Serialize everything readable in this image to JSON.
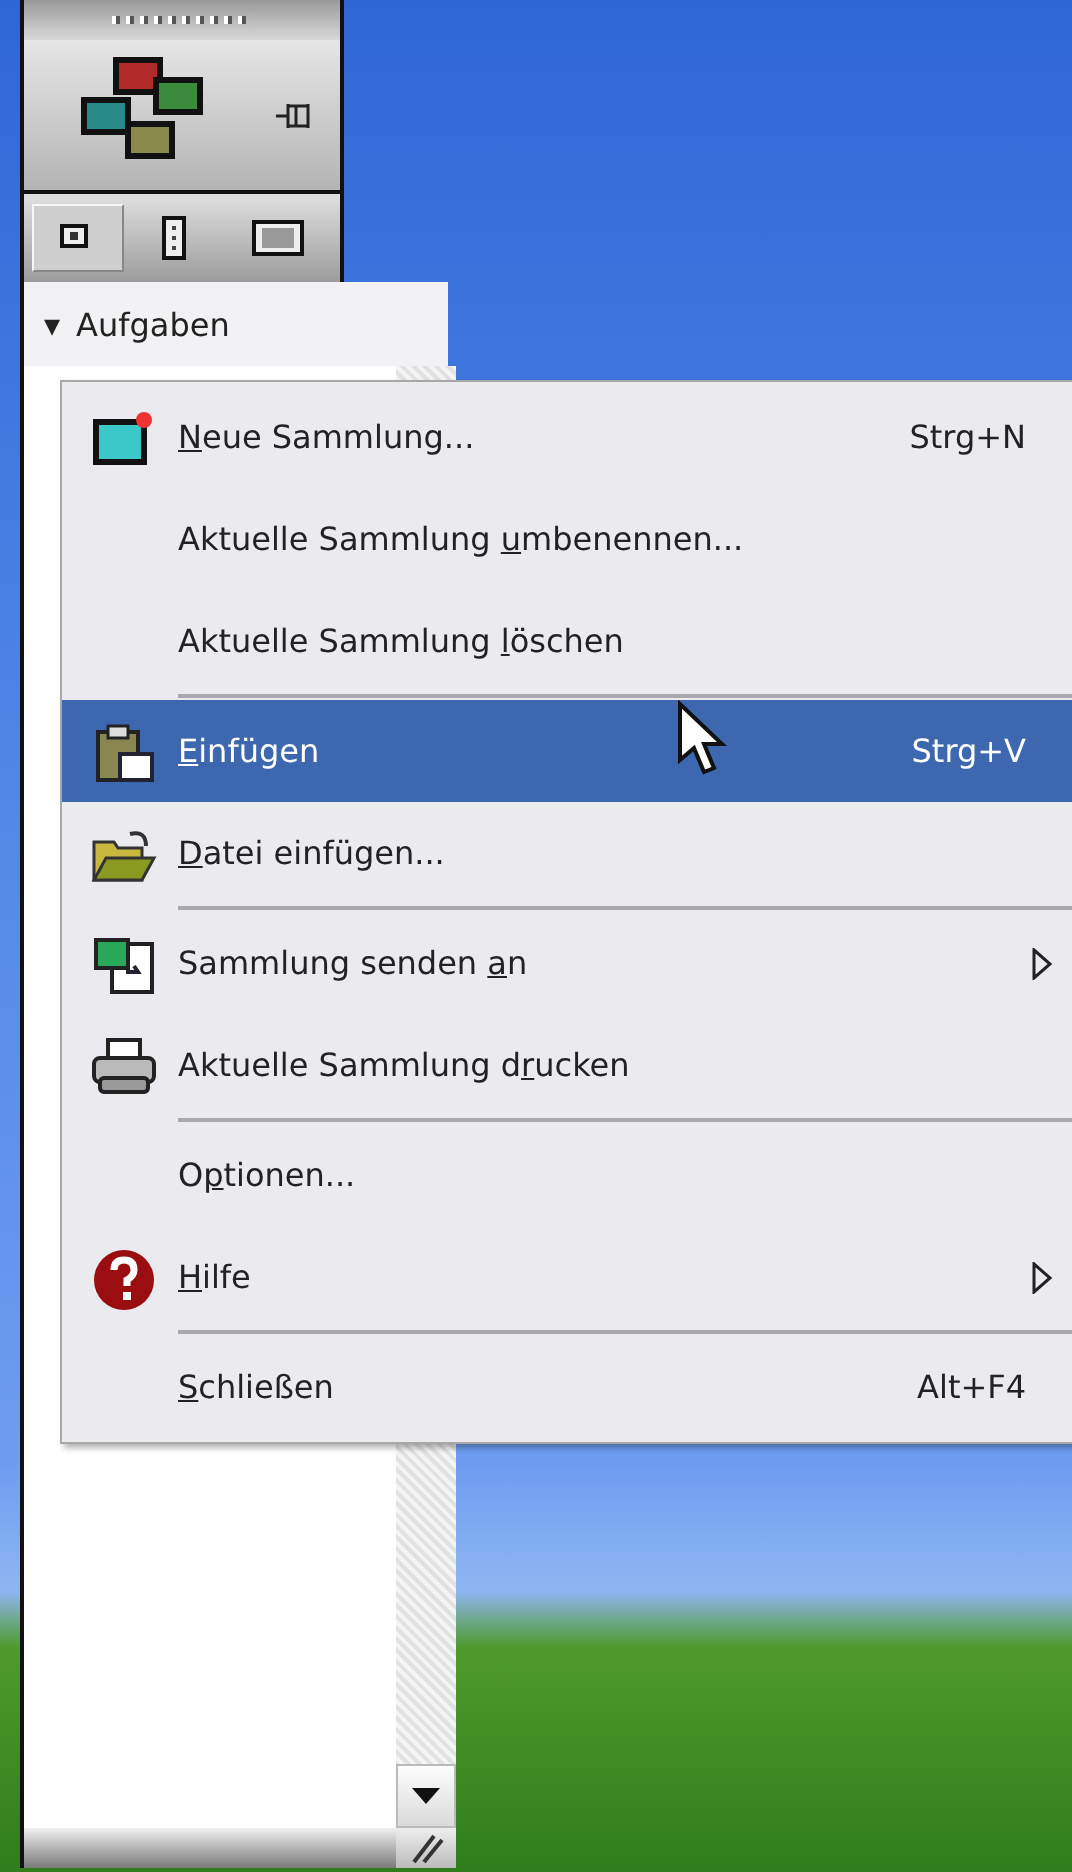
{
  "pane": {
    "view_buttons": [
      {
        "kind": "single",
        "selected": true
      },
      {
        "kind": "list",
        "selected": false
      },
      {
        "kind": "large",
        "selected": false
      }
    ],
    "tasks_header": {
      "arrow": "▾",
      "label": "Aufgaben"
    }
  },
  "menu": {
    "items": [
      {
        "kind": "item",
        "label": {
          "key": "N",
          "after": "eue Sammlung..."
        },
        "shortcut": "Strg+N",
        "submenu": false,
        "selected": false
      },
      {
        "kind": "item",
        "label": {
          "before": "Aktuelle Sammlung ",
          "key": "u",
          "after": "mbenennen..."
        },
        "submenu": false,
        "selected": false
      },
      {
        "kind": "item",
        "label": {
          "before": "Aktuelle Sammlung ",
          "key": "l",
          "after": "öschen"
        },
        "submenu": false,
        "selected": false
      },
      {
        "kind": "separator"
      },
      {
        "kind": "item",
        "label": {
          "key": "E",
          "after": "infügen"
        },
        "shortcut": "Strg+V",
        "submenu": false,
        "selected": true
      },
      {
        "kind": "item",
        "label": {
          "key": "D",
          "after": "atei einfügen..."
        },
        "submenu": false,
        "selected": false
      },
      {
        "kind": "separator"
      },
      {
        "kind": "item",
        "label": {
          "before": "Sammlung senden ",
          "key": "a",
          "after": "n"
        },
        "submenu": true,
        "selected": false
      },
      {
        "kind": "item",
        "label": {
          "before": "Aktuelle Sammlung d",
          "key": "r",
          "after": "ucken"
        },
        "submenu": false,
        "selected": false
      },
      {
        "kind": "separator"
      },
      {
        "kind": "item",
        "label": {
          "before": "O",
          "key": "p",
          "after": "tionen..."
        },
        "submenu": false,
        "selected": false
      },
      {
        "kind": "item",
        "label": {
          "key": "H",
          "after": "ilfe"
        },
        "submenu": true,
        "selected": false
      },
      {
        "kind": "separator"
      },
      {
        "kind": "item",
        "label": {
          "key": "S",
          "after": "chließen"
        },
        "shortcut": "Alt+F4",
        "submenu": false,
        "selected": false
      }
    ]
  }
}
